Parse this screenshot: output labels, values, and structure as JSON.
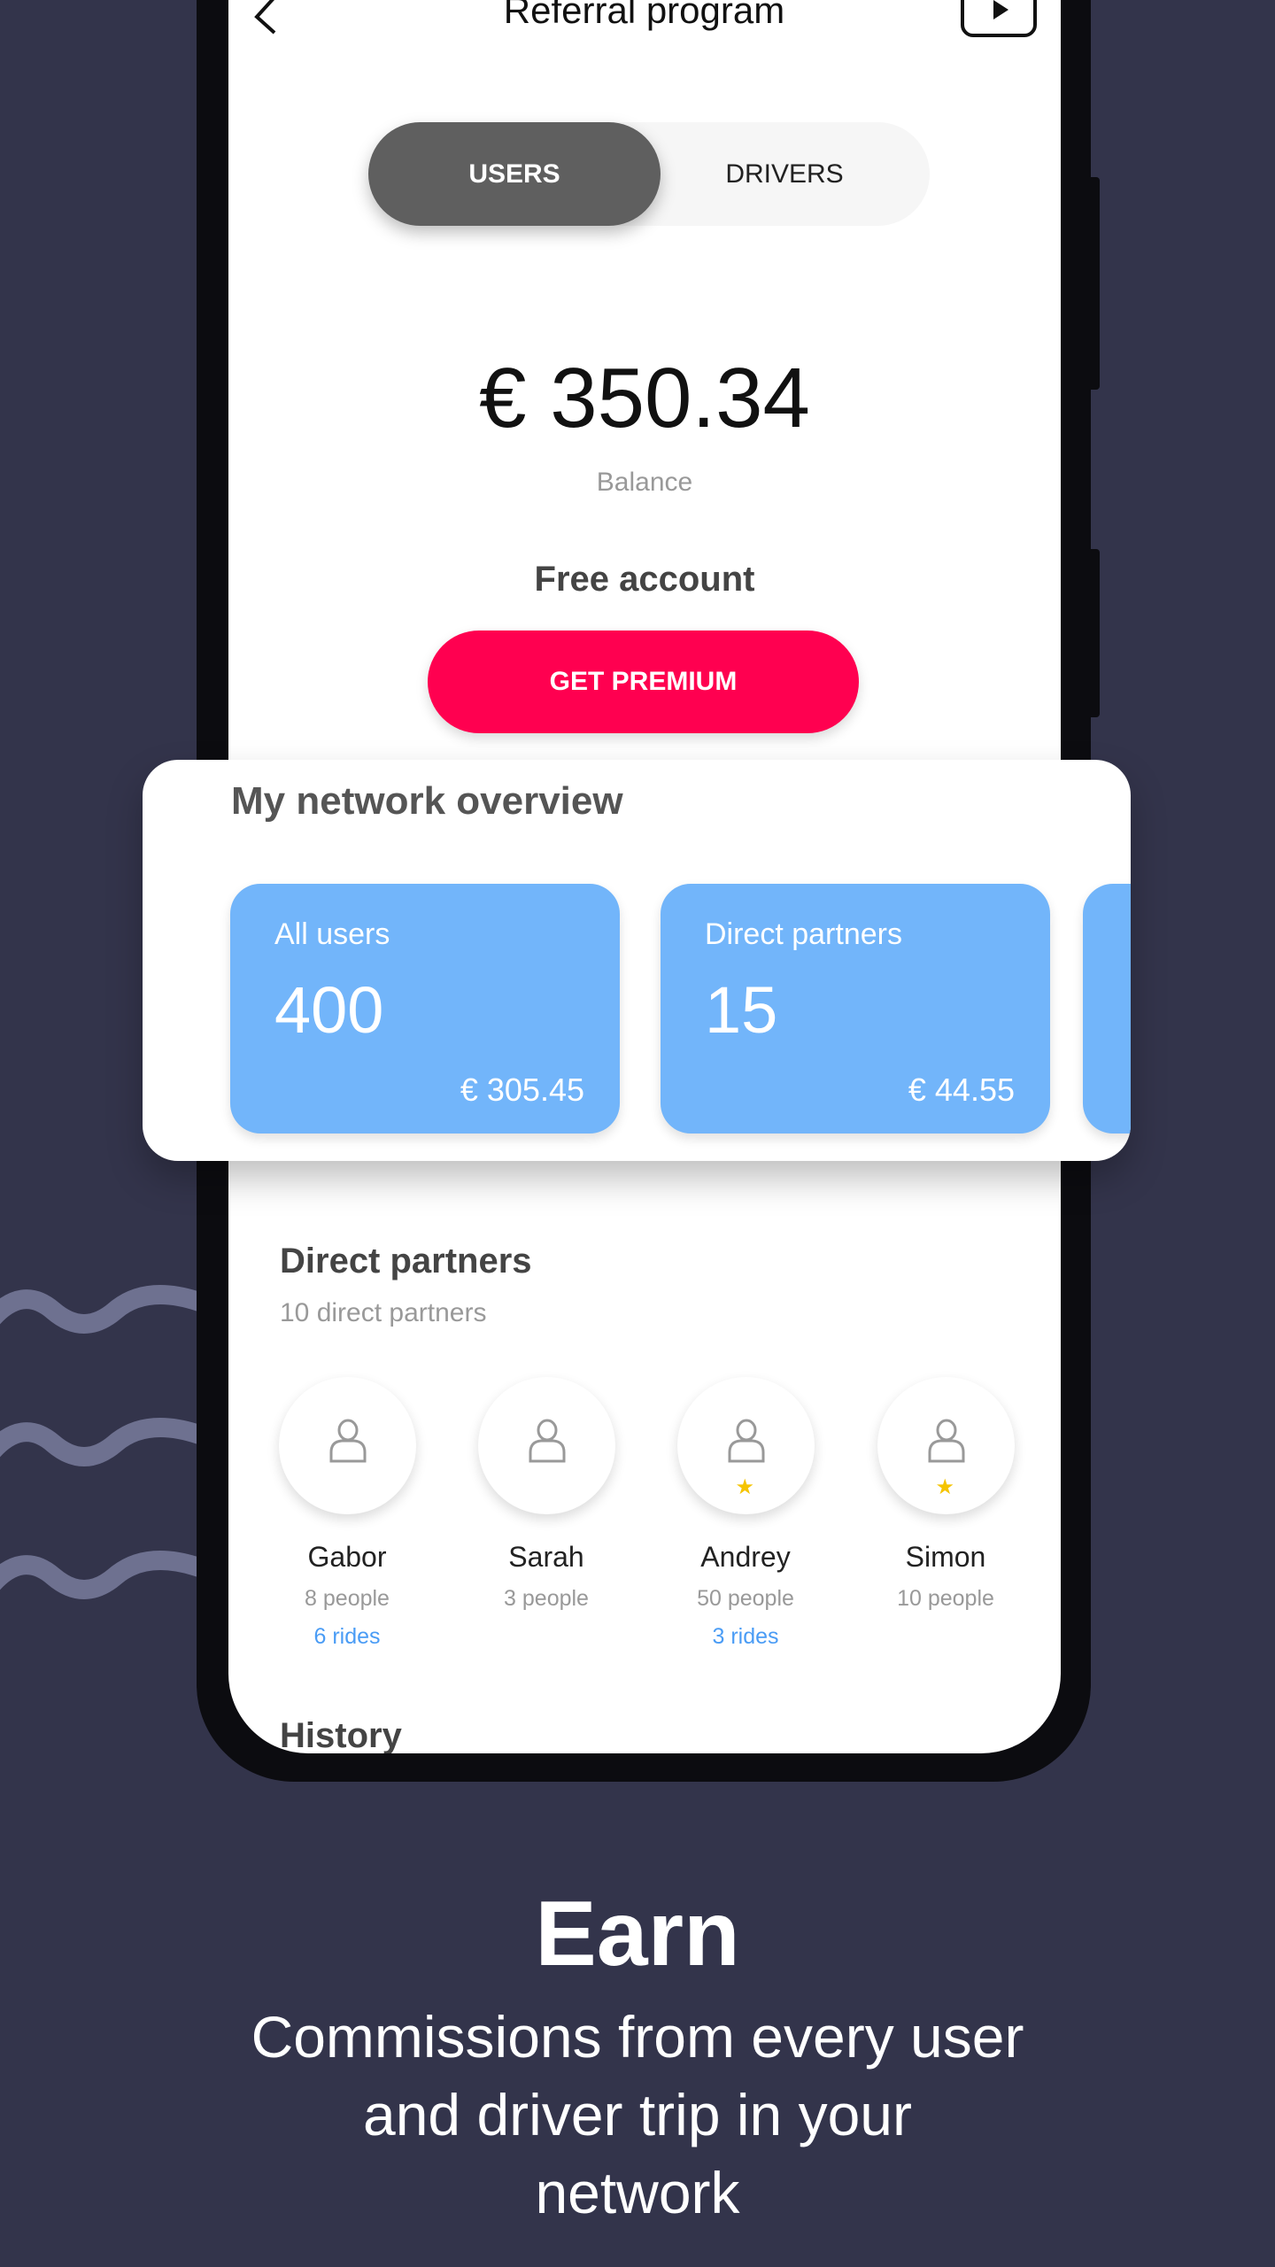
{
  "colors": {
    "background": "#33344b",
    "accent": "#ff0050",
    "tile": "#72b5fa",
    "selected_tab": "#5f5f5f",
    "link": "#4a9cf5",
    "star": "#f5c400"
  },
  "header": {
    "title": "Referral program",
    "back_icon": "chevron-left-icon",
    "video_icon": "play-icon"
  },
  "tabs": [
    {
      "label": "USERS",
      "selected": true
    },
    {
      "label": "DRIVERS",
      "selected": false
    }
  ],
  "balance": {
    "amount": "€ 350.34",
    "label": "Balance"
  },
  "account": {
    "type": "Free account",
    "button": "GET PREMIUM"
  },
  "overview": {
    "title": "My network overview",
    "tiles": [
      {
        "label": "All users",
        "count": "400",
        "amount": "€ 305.45"
      },
      {
        "label": "Direct partners",
        "count": "15",
        "amount": "€ 44.55"
      }
    ]
  },
  "direct_partners": {
    "title": "Direct partners",
    "subtitle": "10 direct partners",
    "partners": [
      {
        "name": "Gabor",
        "people": "8 people",
        "rides": "6 rides",
        "star": false
      },
      {
        "name": "Sarah",
        "people": "3 people",
        "rides": "",
        "star": false
      },
      {
        "name": "Andrey",
        "people": "50 people",
        "rides": "3 rides",
        "star": true
      },
      {
        "name": "Simon",
        "people": "10 people",
        "rides": "",
        "star": true
      }
    ]
  },
  "history": {
    "title": "History"
  },
  "promo": {
    "title": "Earn",
    "lines": [
      "Commissions from every user",
      "and driver trip in your",
      "network"
    ]
  }
}
